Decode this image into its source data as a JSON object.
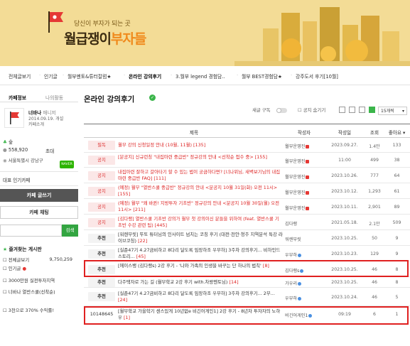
{
  "colors": {
    "banner_bg": "#f3dc96",
    "accent_orange": "#f08a1c",
    "green": "#3bb54a",
    "notice_red": "#d22",
    "highlight_box": "#e02020"
  },
  "banner": {
    "tagline": "당신이 부자가 되는 곳",
    "name_part1": "월급쟁이",
    "name_part2": "부자들"
  },
  "nav": {
    "items": [
      "전체글보기",
      "인기글",
      "월부멘토&튜터칼럼★",
      "온라인 강의후기",
      "3.월부 legend 경험담..",
      "월부 BEST경험담★",
      "강주도서 후기[10월]"
    ],
    "active_index": 3
  },
  "sidebar": {
    "tab_cafe": "카페정보",
    "tab_my": "나의활동",
    "manager_name": "너바나",
    "manager_role": "매니저",
    "since": "2014.09.19. 개설",
    "intro": "카페소개",
    "level_label": "숲",
    "members": "558,920",
    "invite_label": "초대",
    "location": "서울특별시 강남구",
    "badge_text": "NAVER 대표카페",
    "rep_cafe_label": "대표 인기카페",
    "write_button": "카페 글쓰기",
    "chat_button": "카페 채팅",
    "search_button": "검색",
    "fav_header": "즐겨찾는 게시판",
    "fav_items": [
      {
        "label": "전체글보기",
        "count": "9,750,259"
      },
      {
        "label": "인기글",
        "count": ""
      },
      {
        "label": "3000만원 실전투자지역",
        "count": ""
      },
      {
        "label": "너바나 열반스쿨(선착순)",
        "count": ""
      },
      {
        "label": "3천으로 370% 수익률!",
        "count": ""
      }
    ]
  },
  "board": {
    "title": "온라인 강의후기",
    "subscribe_label": "새글 구독",
    "hide_notice_label": "공지 숨기기",
    "per_page": "15개씩",
    "columns": {
      "title": "제목",
      "author": "작성자",
      "date": "작성일",
      "views": "조회",
      "likes": "좋아요"
    },
    "rows": [
      {
        "tag": "필독",
        "title": "월부 강의 신청일정 안내 (10월, 11월)",
        "count": "[135]",
        "author": "월부운영진",
        "date": "2023.09.27.",
        "views": "1.4만",
        "likes": "133",
        "type": "notice"
      },
      {
        "tag": "공지",
        "title": "[분공지] 신규런칭 \"내집마련 중급반\" 정규강의 안내 <선착순 접수 중>",
        "count": "[155]",
        "author": "월부운영진",
        "date": "11:00",
        "views": "499",
        "likes": "38",
        "type": "notice"
      },
      {
        "tag": "공지",
        "title": "내집마련 잘하고 갈아타기 할 수 있는 법이 궁금하다면? [너나위님, 새벽보기님의 내집마련 중급반 FAQ]",
        "count": "[111]",
        "author": "월부운영진",
        "date": "2023.10.26.",
        "views": "777",
        "likes": "64",
        "type": "notice"
      },
      {
        "tag": "공지",
        "title": "(예정) 월부 \"열반스쿨 중급반\" 정규강의 안내 <분공지 10월 31일(화) 오전 11시>",
        "count": "[155]",
        "author": "월부운영진",
        "date": "2023.10.12.",
        "views": "1,293",
        "likes": "61",
        "type": "notice"
      },
      {
        "tag": "공지",
        "title": "(예정) 월부 \"왜 바뀐! 지방투자 기초반\" 정규강의 안내 <분공지 10월 30일(월) 오전 11시>",
        "count": "[211]",
        "author": "월부운영진",
        "date": "2023.10.11.",
        "views": "2,901",
        "likes": "89",
        "type": "notice"
      },
      {
        "tag": "공지",
        "title": "[김다랭] 열반스쿨 기초반 강의가 월부 첫 강의이신 분들을 위하여 (feat. 열반스쿨 기초반 수강 관련 팁)",
        "count": "[445]",
        "author": "김다랭",
        "date": "2021.05.18.",
        "views": "2.1만",
        "likes": "509",
        "type": "notice"
      },
      {
        "tag": "추천",
        "title": "[워렌부릿] 뚜또 튜터님의 인사이트 넘치는 코칭 후기 (대전·천안·청주 지역분석 특강 라이브코칭)",
        "count": "[22]",
        "author": "워렌부릿",
        "date": "2023.10.25.",
        "views": "50",
        "likes": "9",
        "type": "rec"
      },
      {
        "tag": "추천",
        "title": "[실준47기 4.27금비하고 8다리 달도록 임장하조 우부하] 3주차 강의후기... 비하인드 스토리...",
        "count": "[45]",
        "author": "우부하",
        "date": "2023.10.23.",
        "views": "129",
        "likes": "9",
        "type": "rec"
      },
      {
        "tag": "추천",
        "title": "[에이스뱅 (김다랭s) 2강 후기 - '나와 가족의 인생을 바꾸는 단 하나의 법칙'",
        "count": "[8]",
        "author": "김다랭s",
        "date": "2023.10.25.",
        "views": "46",
        "likes": "8",
        "type": "rec"
      },
      {
        "tag": "추천",
        "title": "다주택자로 가는 길 (월부학교 2강 후기 with.차왕멘토님)",
        "count": "[14]",
        "author": "가우리",
        "date": "2023.10.25.",
        "views": "46",
        "likes": "8",
        "type": "rec"
      },
      {
        "tag": "추천",
        "title": "[실준47기 4.27금비하고 8다리 달도록 임장하조 우부하] 3주차 강의후기... 2부...",
        "count": "[24]",
        "author": "우부하",
        "date": "2023.10.24.",
        "views": "46",
        "likes": "5",
        "type": "rec"
      },
      {
        "tag": "10148645",
        "title": "[월부학교 가을학기 센스있게 10년없e 비긴어게인1] 2강 후기 - 8년차 투자자의 노하우",
        "count": "[1]",
        "author": "비긴어게인1",
        "date": "09:19",
        "views": "6",
        "likes": "1",
        "type": "num"
      }
    ]
  }
}
